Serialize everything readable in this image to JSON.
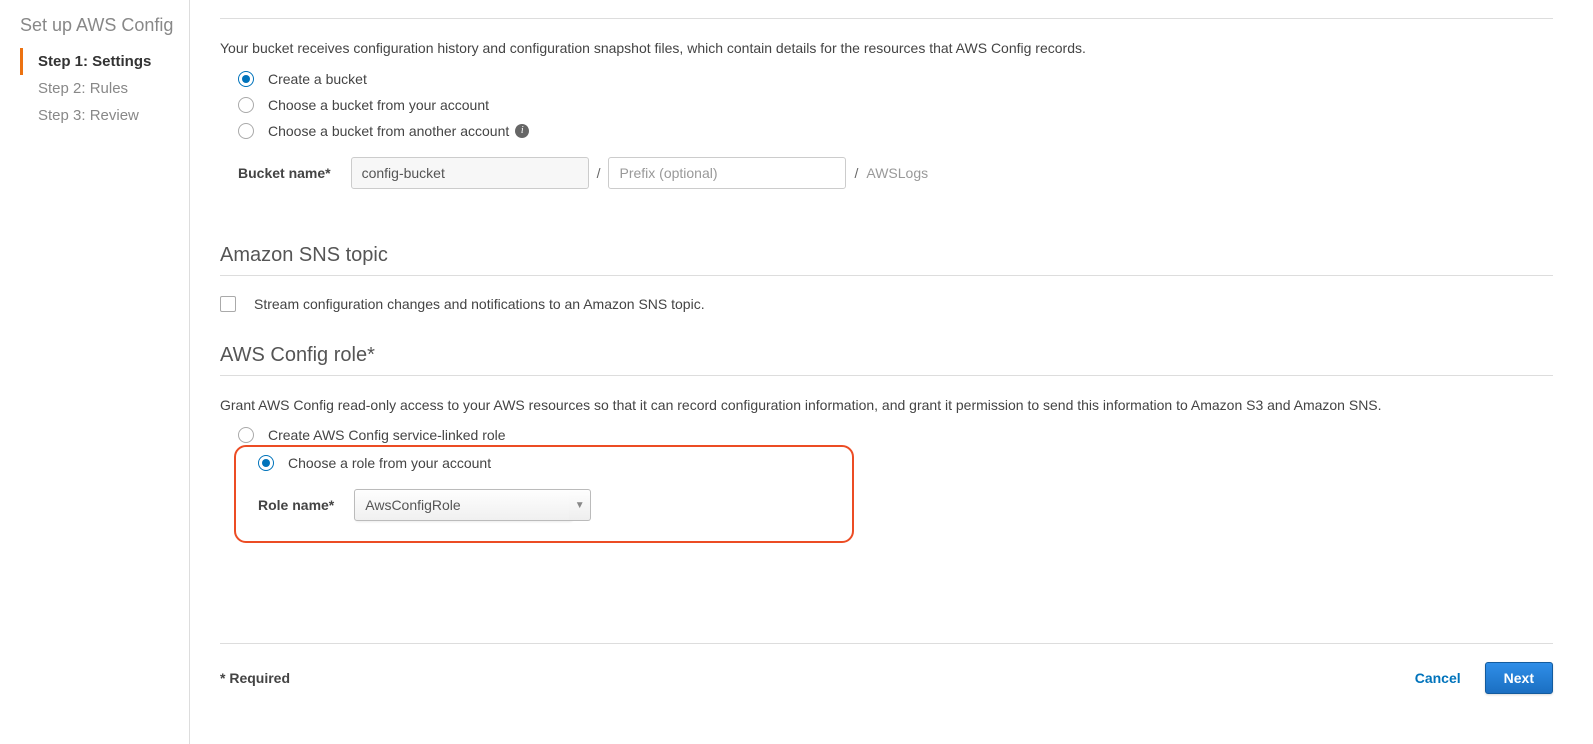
{
  "sidebar": {
    "title": "Set up AWS Config",
    "steps": [
      {
        "label": "Step 1: Settings",
        "active": true
      },
      {
        "label": "Step 2: Rules",
        "active": false
      },
      {
        "label": "Step 3: Review",
        "active": false
      }
    ]
  },
  "bucket": {
    "desc": "Your bucket receives configuration history and configuration snapshot files, which contain details for the resources that AWS Config records.",
    "options": [
      {
        "label": "Create a bucket",
        "checked": true,
        "info": false
      },
      {
        "label": "Choose a bucket from your account",
        "checked": false,
        "info": false
      },
      {
        "label": "Choose a bucket from another account",
        "checked": false,
        "info": true
      }
    ],
    "field_label": "Bucket name*",
    "name_value": "config-bucket",
    "prefix_placeholder": "Prefix (optional)",
    "slash": "/",
    "suffix": "AWSLogs"
  },
  "sns": {
    "title": "Amazon SNS topic",
    "checkbox_label": "Stream configuration changes and notifications to an Amazon SNS topic."
  },
  "role": {
    "title": "AWS Config role*",
    "desc": "Grant AWS Config read-only access to your AWS resources so that it can record configuration information, and grant it permission to send this information to Amazon S3 and Amazon SNS.",
    "options": [
      {
        "label": "Create AWS Config service-linked role",
        "checked": false
      },
      {
        "label": "Choose a role from your account",
        "checked": true
      }
    ],
    "field_label": "Role name*",
    "value": "AwsConfigRole"
  },
  "footer": {
    "required": "* Required",
    "cancel": "Cancel",
    "next": "Next"
  }
}
